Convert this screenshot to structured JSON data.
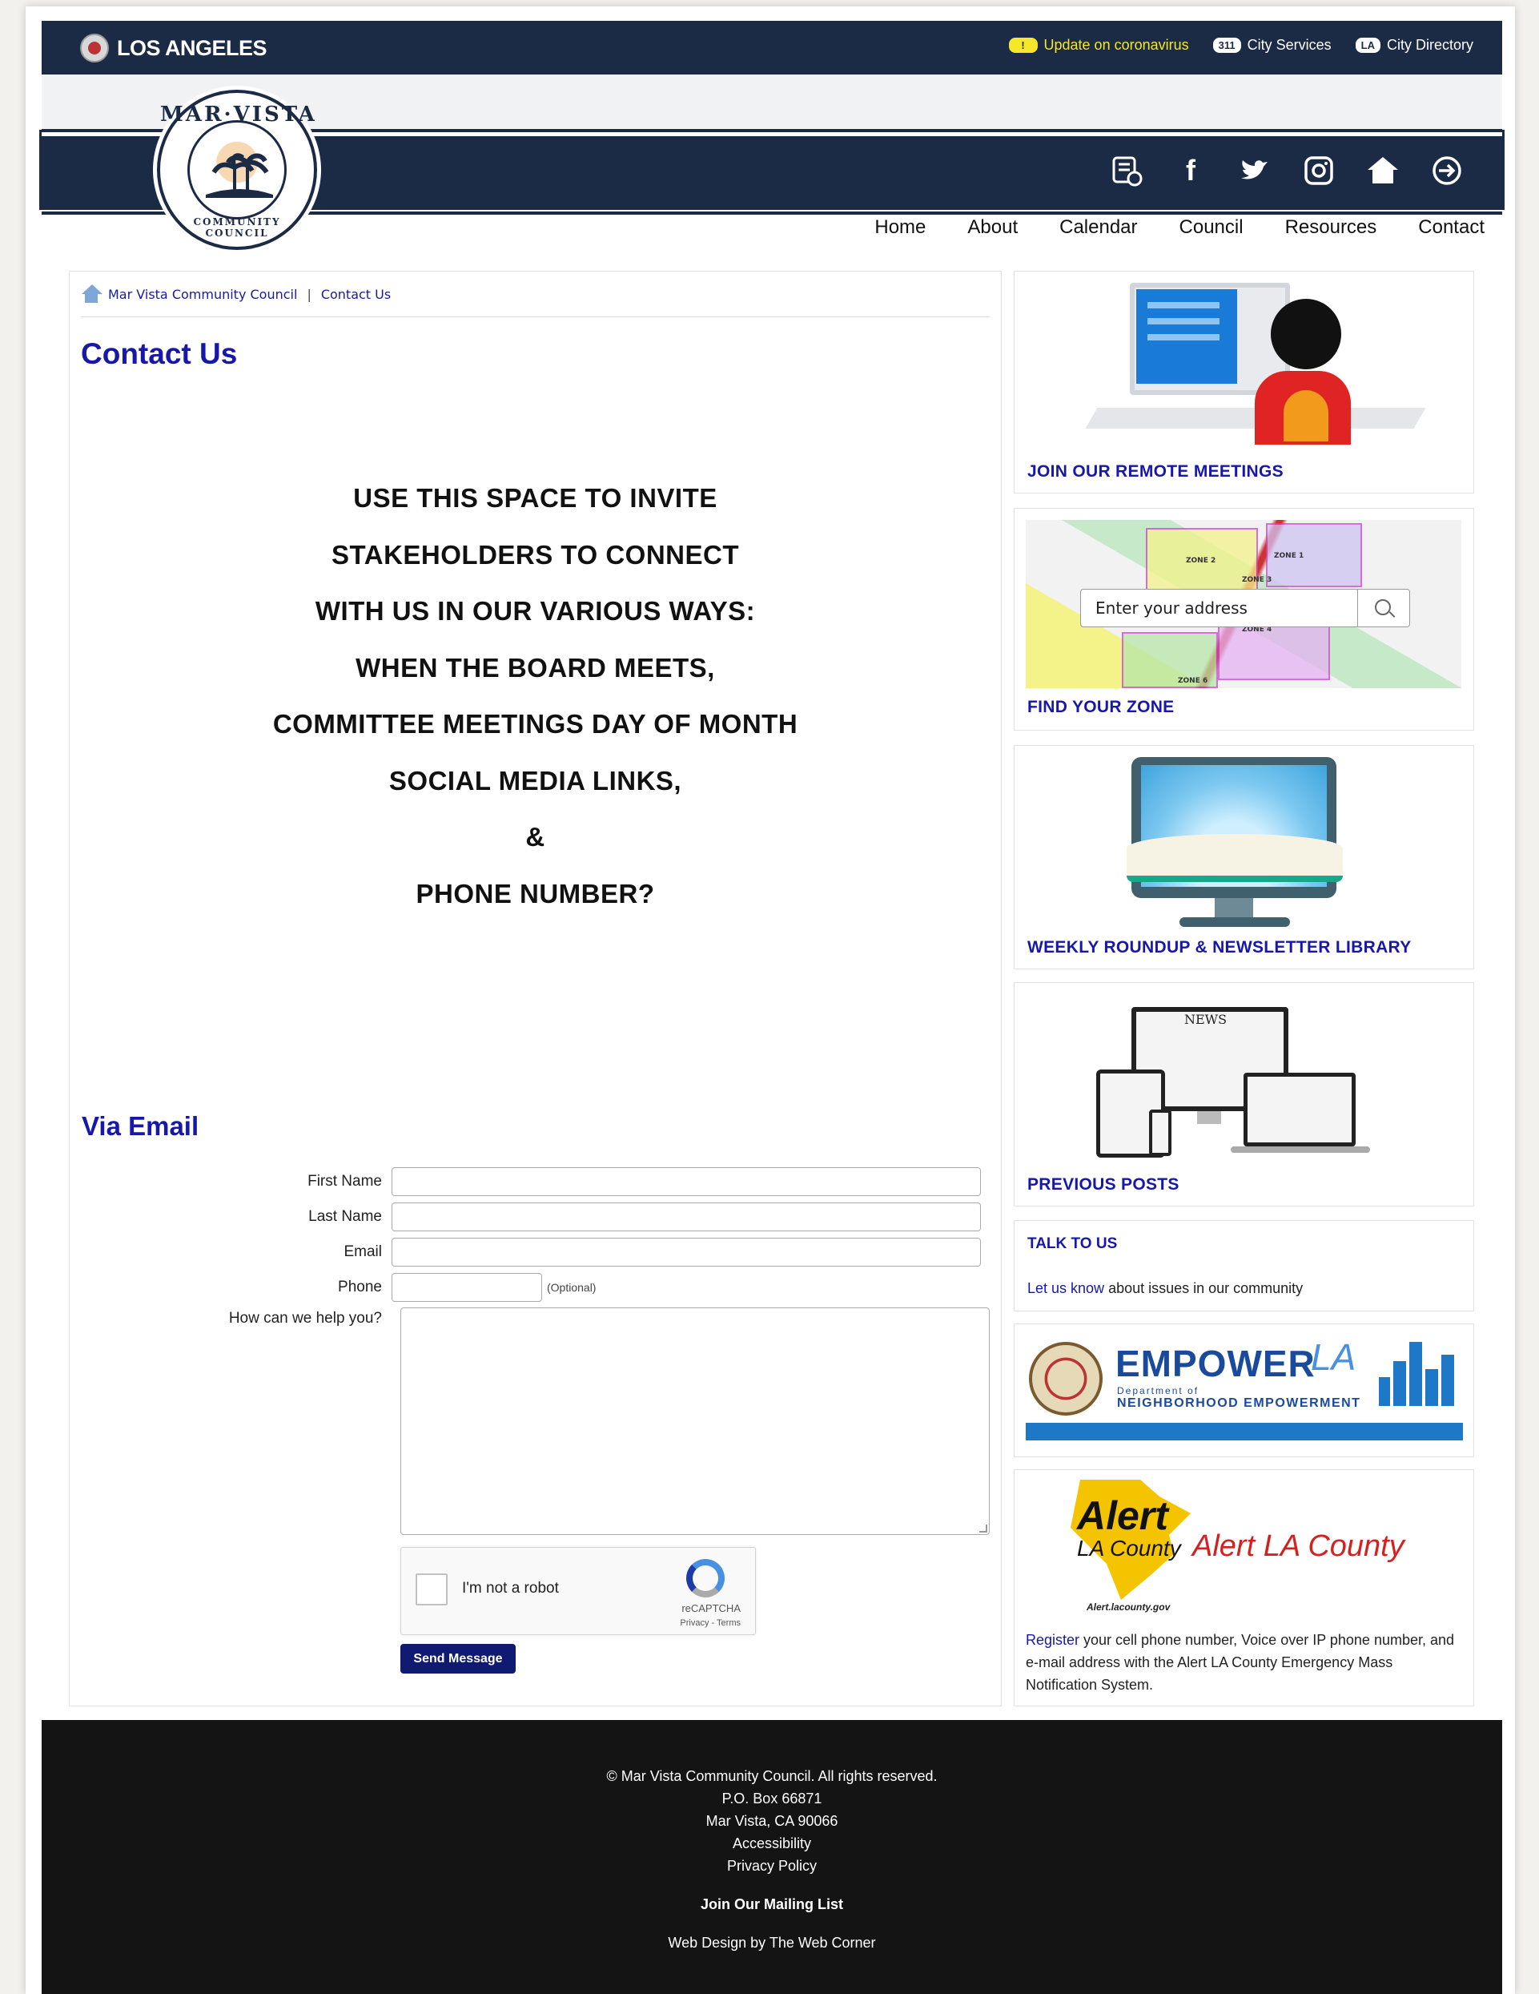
{
  "topbar": {
    "brand": "LOS ANGELES",
    "links": [
      {
        "badge": "!",
        "label": "Update on coronavirus"
      },
      {
        "badge": "311",
        "label": "City Services"
      },
      {
        "badge": "LA",
        "label": "City Directory"
      }
    ]
  },
  "seal": {
    "top_text": "MAR·VISTA",
    "bottom_text": "COMMUNITY COUNCIL"
  },
  "social_icons": [
    "newsletter-icon",
    "facebook-icon",
    "twitter-icon",
    "instagram-icon",
    "home-icon",
    "login-icon"
  ],
  "nav": [
    "Home",
    "About",
    "Calendar",
    "Council",
    "Resources",
    "Contact"
  ],
  "breadcrumb": {
    "items": [
      "Mar Vista Community Council",
      "Contact Us"
    ],
    "separator": "|"
  },
  "page_title": "Contact Us",
  "invite_lines": [
    "USE THIS SPACE TO INVITE",
    "STAKEHOLDERS TO CONNECT",
    "WITH US IN OUR VARIOUS WAYS:",
    "WHEN THE BOARD MEETS,",
    "COMMITTEE MEETINGS DAY OF MONTH",
    "SOCIAL MEDIA LINKS,",
    "&",
    "PHONE NUMBER?"
  ],
  "form": {
    "title": "Via Email",
    "first_name_label": "First Name",
    "last_name_label": "Last Name",
    "email_label": "Email",
    "phone_label": "Phone",
    "phone_note": "(Optional)",
    "message_label": "How can we help you?",
    "captcha_label": "I'm not a robot",
    "captcha_brand": "reCAPTCHA",
    "captcha_terms": "Privacy - Terms",
    "submit_label": "Send Message"
  },
  "sidebar": {
    "remote_meetings": "JOIN OUR REMOTE MEETINGS",
    "zone": {
      "placeholder": "Enter your address",
      "caption": "FIND YOUR ZONE",
      "zones": [
        "ZONE 1",
        "ZONE 2",
        "ZONE 3",
        "ZONE 4",
        "ZONE 6"
      ]
    },
    "library": "WEEKLY ROUNDUP & NEWSLETTER LIBRARY",
    "previous_posts": {
      "caption": "PREVIOUS POSTS",
      "news_label": "NEWS"
    },
    "talk": {
      "title": "TALK TO US",
      "link": "Let us know",
      "text": " about issues in our community"
    },
    "empower": {
      "word": "EMPOWER",
      "la": "LA",
      "sub1": "Department of",
      "sub2": "NEIGHBORHOOD EMPOWERMENT"
    },
    "alert": {
      "word": "Alert",
      "la_county": "LA County",
      "title_red": "Alert LA County",
      "url": "Alert.lacounty.gov",
      "link": "Register",
      "text": " your cell phone number, Voice over IP phone number, and e-mail address with the Alert LA County Emergency Mass Notification System."
    }
  },
  "footer": {
    "copyright": "© Mar Vista Community Council. All rights reserved.",
    "po_box": "P.O. Box 66871",
    "city": "Mar Vista, CA 90066",
    "accessibility": "Accessibility",
    "privacy": "Privacy Policy",
    "mailing": "Join Our Mailing List",
    "credit": "Web Design by The Web Corner"
  },
  "colors": {
    "navy": "#1b2a45",
    "link_blue": "#1818a8",
    "button": "#101a70",
    "alert_yellow": "#f6e72a"
  }
}
